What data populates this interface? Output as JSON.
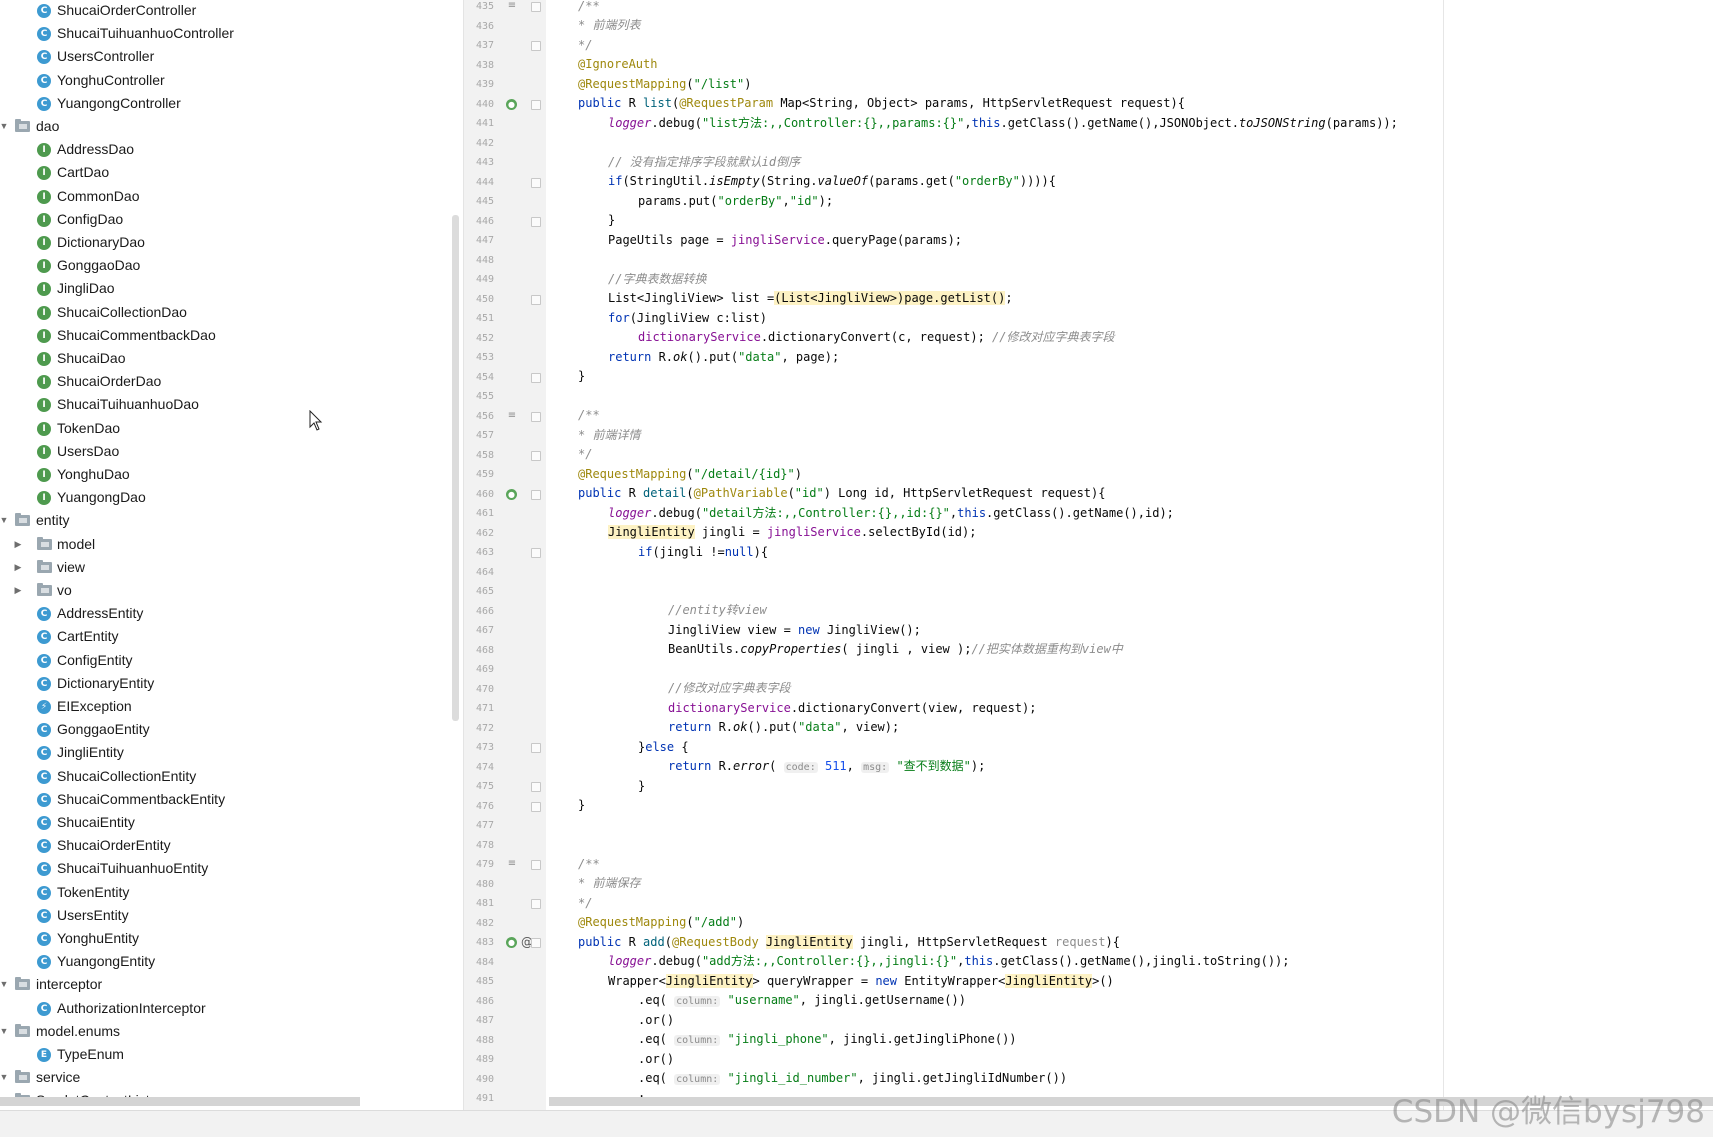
{
  "tree": {
    "items": [
      {
        "label": "ShucaiOrderController",
        "kind": "class"
      },
      {
        "label": "ShucaiTuihuanhuoController",
        "kind": "class"
      },
      {
        "label": "UsersController",
        "kind": "class"
      },
      {
        "label": "YonghuController",
        "kind": "class"
      },
      {
        "label": "YuangongController",
        "kind": "class"
      },
      {
        "label": "dao",
        "kind": "package",
        "expanded": true
      },
      {
        "label": "AddressDao",
        "kind": "interface"
      },
      {
        "label": "CartDao",
        "kind": "interface"
      },
      {
        "label": "CommonDao",
        "kind": "interface"
      },
      {
        "label": "ConfigDao",
        "kind": "interface"
      },
      {
        "label": "DictionaryDao",
        "kind": "interface"
      },
      {
        "label": "GonggaoDao",
        "kind": "interface"
      },
      {
        "label": "JingliDao",
        "kind": "interface"
      },
      {
        "label": "ShucaiCollectionDao",
        "kind": "interface"
      },
      {
        "label": "ShucaiCommentbackDao",
        "kind": "interface"
      },
      {
        "label": "ShucaiDao",
        "kind": "interface"
      },
      {
        "label": "ShucaiOrderDao",
        "kind": "interface"
      },
      {
        "label": "ShucaiTuihuanhuoDao",
        "kind": "interface"
      },
      {
        "label": "TokenDao",
        "kind": "interface"
      },
      {
        "label": "UsersDao",
        "kind": "interface"
      },
      {
        "label": "YonghuDao",
        "kind": "interface"
      },
      {
        "label": "YuangongDao",
        "kind": "interface"
      },
      {
        "label": "entity",
        "kind": "package",
        "expanded": true
      },
      {
        "label": "model",
        "kind": "subpackage",
        "expanded": false
      },
      {
        "label": "view",
        "kind": "subpackage",
        "expanded": false
      },
      {
        "label": "vo",
        "kind": "subpackage",
        "expanded": false
      },
      {
        "label": "AddressEntity",
        "kind": "class"
      },
      {
        "label": "CartEntity",
        "kind": "class"
      },
      {
        "label": "ConfigEntity",
        "kind": "class"
      },
      {
        "label": "DictionaryEntity",
        "kind": "class"
      },
      {
        "label": "EIException",
        "kind": "exception"
      },
      {
        "label": "GonggaoEntity",
        "kind": "class"
      },
      {
        "label": "JingliEntity",
        "kind": "class"
      },
      {
        "label": "ShucaiCollectionEntity",
        "kind": "class"
      },
      {
        "label": "ShucaiCommentbackEntity",
        "kind": "class"
      },
      {
        "label": "ShucaiEntity",
        "kind": "class"
      },
      {
        "label": "ShucaiOrderEntity",
        "kind": "class"
      },
      {
        "label": "ShucaiTuihuanhuoEntity",
        "kind": "class"
      },
      {
        "label": "TokenEntity",
        "kind": "class"
      },
      {
        "label": "UsersEntity",
        "kind": "class"
      },
      {
        "label": "YonghuEntity",
        "kind": "class"
      },
      {
        "label": "YuangongEntity",
        "kind": "class"
      },
      {
        "label": "interceptor",
        "kind": "package",
        "expanded": true
      },
      {
        "label": "AuthorizationInterceptor",
        "kind": "class"
      },
      {
        "label": "model.enums",
        "kind": "package",
        "expanded": true
      },
      {
        "label": "TypeEnum",
        "kind": "enum"
      },
      {
        "label": "service",
        "kind": "package",
        "expanded": true
      },
      {
        "label": "ServletContextListener",
        "kind": "package",
        "expanded": true
      }
    ]
  },
  "editor": {
    "line_numbers": [
      "435",
      "436",
      "437",
      "438",
      "439",
      "440",
      "441",
      "442",
      "443",
      "444",
      "445",
      "446",
      "447",
      "448",
      "449",
      "450",
      "451",
      "452",
      "453",
      "454",
      "455",
      "456",
      "457",
      "458",
      "459",
      "460",
      "461",
      "462",
      "463",
      "464",
      "465",
      "466",
      "467",
      "468",
      "469",
      "470",
      "471",
      "472",
      "473",
      "474",
      "475",
      "476",
      "477",
      "478",
      "479",
      "480",
      "481",
      "482",
      "483",
      "484",
      "485",
      "486",
      "487",
      "488",
      "489",
      "490",
      "491"
    ],
    "icons": {
      "bean": "spring-bean-icon",
      "doc": "doc-comment-icon",
      "at": "override-at-icon",
      "fold": "fold-marker-icon"
    }
  },
  "watermark": "CSDN @微信bysj798"
}
